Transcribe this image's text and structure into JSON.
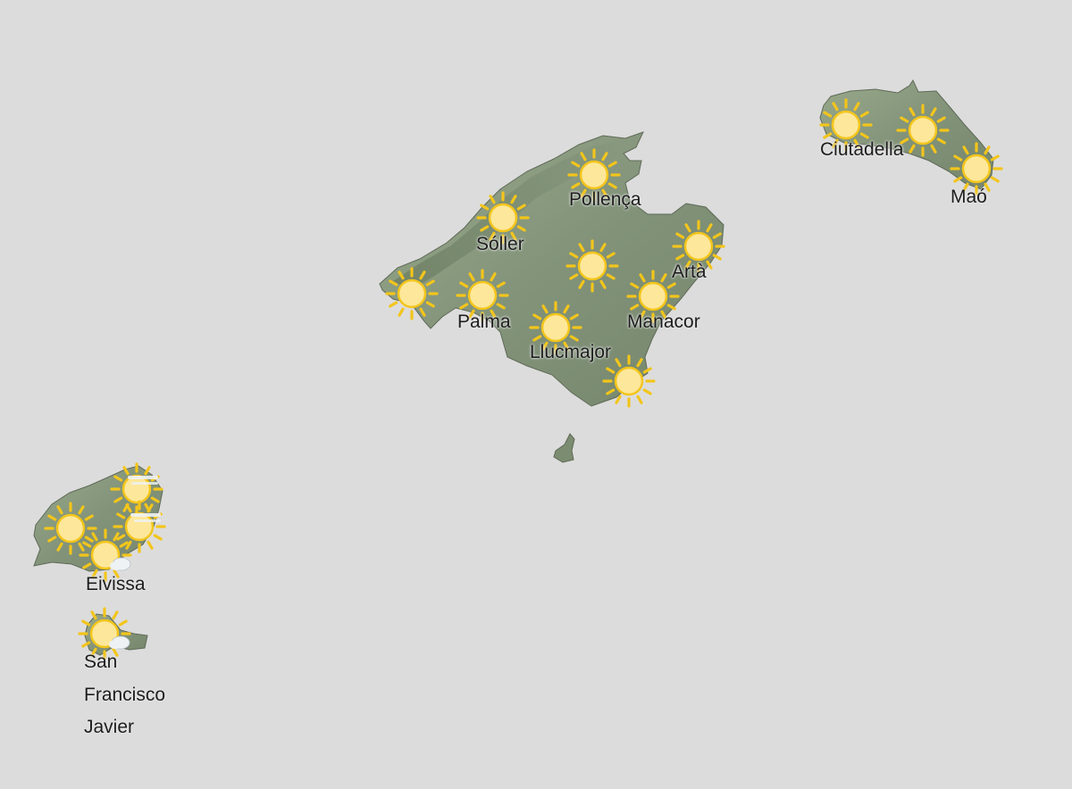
{
  "colors": {
    "sea": "#dcdcdc",
    "land": "#8a9a7d",
    "land_dark": "#6f8062",
    "sun": "#fde79a",
    "sun_ray": "#f3c51b",
    "cloud": "#eef2f5"
  },
  "towns": {
    "pollenca": "Pollença",
    "soller": "Sóller",
    "arta": "Artà",
    "palma": "Palma",
    "manacor": "Manacor",
    "llucmajor": "Llucmajor",
    "ciutadella": "Ciutadella",
    "mao": "Maó",
    "eivissa": "Eivissa",
    "san_francisco_javier": [
      "San",
      "Francisco",
      "Javier"
    ]
  },
  "icons": [
    {
      "name": "sun-icon-pollenca",
      "type": "sunny"
    },
    {
      "name": "sun-icon-soller",
      "type": "sunny"
    },
    {
      "name": "sun-icon-center-mallorca",
      "type": "sunny"
    },
    {
      "name": "sun-icon-arta",
      "type": "sunny"
    },
    {
      "name": "sun-icon-west-mallorca",
      "type": "sunny"
    },
    {
      "name": "sun-icon-palma",
      "type": "sunny"
    },
    {
      "name": "sun-icon-manacor",
      "type": "sunny"
    },
    {
      "name": "sun-icon-llucmajor",
      "type": "sunny"
    },
    {
      "name": "sun-icon-southeast-mallorca",
      "type": "sunny"
    },
    {
      "name": "sun-icon-ciutadella",
      "type": "sunny"
    },
    {
      "name": "sun-icon-menorca-center",
      "type": "sunny"
    },
    {
      "name": "sun-icon-mao",
      "type": "sunny"
    },
    {
      "name": "sun-haze-icon-ibiza-north",
      "type": "sunny-haze"
    },
    {
      "name": "sun-haze-icon-ibiza-east",
      "type": "sunny-haze"
    },
    {
      "name": "sun-icon-ibiza-west",
      "type": "sunny"
    },
    {
      "name": "sun-cloud-icon-eivissa",
      "type": "sunny-cloud"
    },
    {
      "name": "sun-cloud-icon-formentera",
      "type": "sunny-cloud"
    }
  ]
}
